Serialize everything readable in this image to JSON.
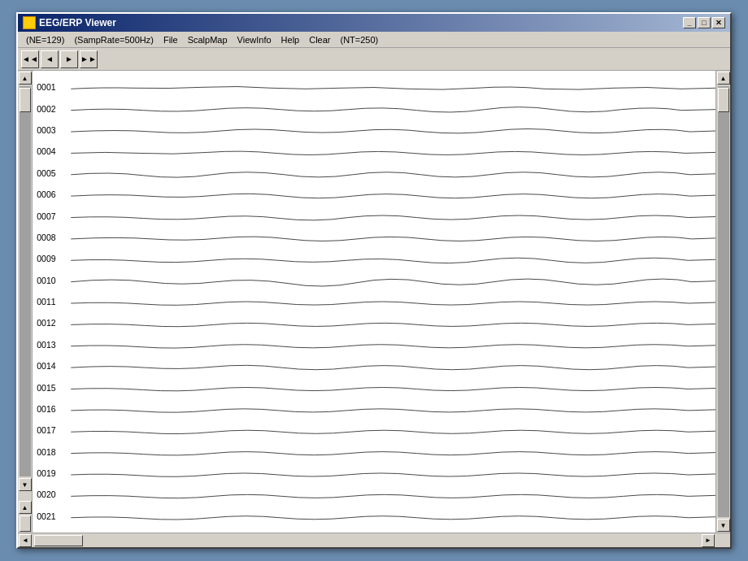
{
  "window": {
    "title": "EEG/ERP Viewer",
    "icon_label": "EEG"
  },
  "title_controls": {
    "minimize": "_",
    "maximize": "□",
    "close": "✕"
  },
  "menu": {
    "info_ne": "(NE=129)",
    "info_samp": "(SampRate=500Hz)",
    "file": "File",
    "scalpmap": "ScalpMap",
    "viewinfo": "ViewInfo",
    "help": "Help",
    "clear": "Clear",
    "info_nt": "(NT=250)"
  },
  "channels": [
    "0001",
    "0002",
    "0003",
    "0004",
    "0005",
    "0006",
    "0007",
    "0008",
    "0009",
    "0010",
    "0011",
    "0012",
    "0013",
    "0014",
    "0015",
    "0016",
    "0017",
    "0018",
    "0019",
    "0020",
    "0021"
  ],
  "scroll": {
    "up": "▲",
    "down": "▼",
    "left": "◄",
    "right": "►"
  }
}
